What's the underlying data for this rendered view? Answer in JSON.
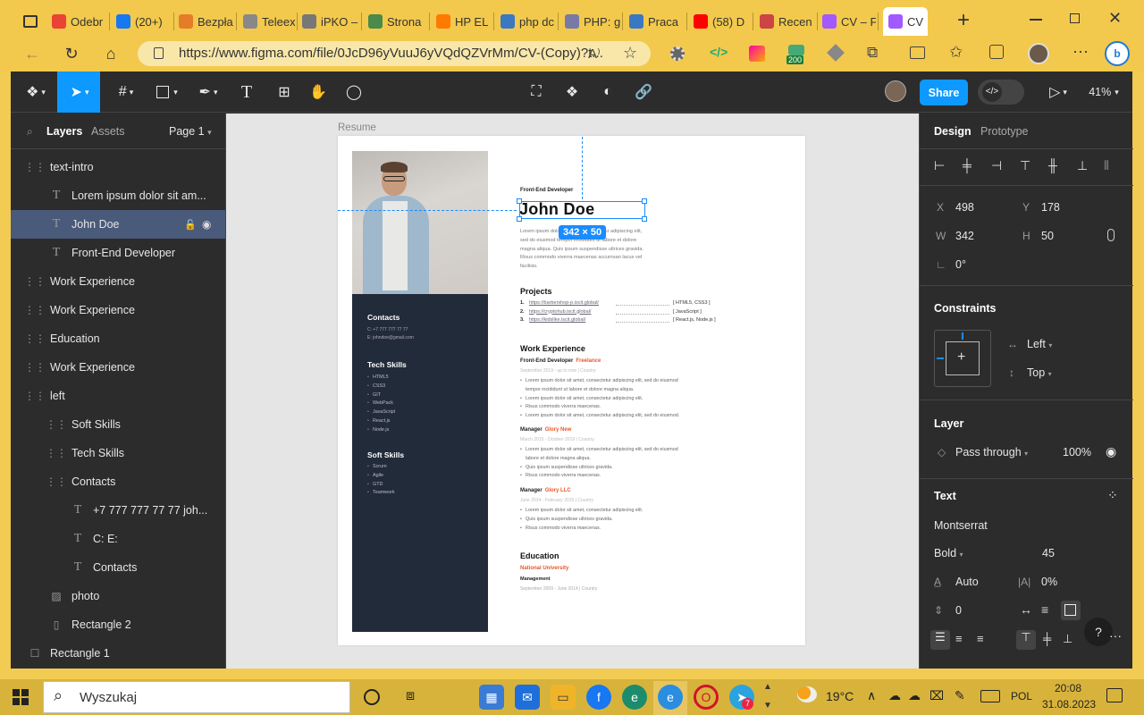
{
  "browser": {
    "tabs": [
      {
        "label": "",
        "color": "#444"
      },
      {
        "label": "Odebr",
        "color": "#ea4335"
      },
      {
        "label": "(20+)",
        "color": "#1877f2"
      },
      {
        "label": "Bezpła",
        "color": "#e57c2a"
      },
      {
        "label": "Teleex",
        "color": "#888"
      },
      {
        "label": "iPKO –",
        "color": "#777"
      },
      {
        "label": "Strona",
        "color": "#4a8a4a"
      },
      {
        "label": "HP EL",
        "color": "#ff7a00"
      },
      {
        "label": "php dc",
        "color": "#3a78c2"
      },
      {
        "label": "PHP: g",
        "color": "#777aa7"
      },
      {
        "label": "Praca",
        "color": "#3a78c2"
      },
      {
        "label": "(58) D",
        "color": "#ff0000"
      },
      {
        "label": "Recen",
        "color": "#c44"
      },
      {
        "label": "CV – F",
        "color": "#a259ff"
      },
      {
        "label": "CV",
        "color": "#a259ff"
      }
    ],
    "new_tab": "+",
    "url": "https://www.figma.com/file/0JcD96yVuuJ6yVQdQZVrMm/CV-(Copy)?t...",
    "badge": "200"
  },
  "figma": {
    "share_label": "Share",
    "zoom": "41%",
    "left_tabs": {
      "layers": "Layers",
      "assets": "Assets",
      "page": "Page 1"
    },
    "layers": [
      {
        "label": "text-intro",
        "indent": 1,
        "icon": "frame"
      },
      {
        "label": "Lorem ipsum dolor sit am...",
        "indent": 2,
        "icon": "text"
      },
      {
        "label": "John Doe",
        "indent": 2,
        "icon": "text",
        "selected": true
      },
      {
        "label": "Front-End Developer",
        "indent": 2,
        "icon": "text"
      },
      {
        "label": "Work Experience",
        "indent": 1,
        "icon": "frame"
      },
      {
        "label": "Work Experience",
        "indent": 1,
        "icon": "frame"
      },
      {
        "label": "Education",
        "indent": 1,
        "icon": "frame"
      },
      {
        "label": "Work Experience",
        "indent": 1,
        "icon": "frame"
      },
      {
        "label": "left",
        "indent": 1,
        "icon": "frame"
      },
      {
        "label": "Soft Skills",
        "indent": 2,
        "icon": "frame"
      },
      {
        "label": "Tech Skills",
        "indent": 2,
        "icon": "frame"
      },
      {
        "label": "Contacts",
        "indent": 2,
        "icon": "frame"
      },
      {
        "label": "+7 777 777 77 77 joh...",
        "indent": 3,
        "icon": "text"
      },
      {
        "label": "C: E:",
        "indent": 3,
        "icon": "text"
      },
      {
        "label": "Contacts",
        "indent": 3,
        "icon": "text"
      },
      {
        "label": "photo",
        "indent": 2,
        "icon": "image"
      },
      {
        "label": "Rectangle 2",
        "indent": 2,
        "icon": "rect-thin"
      },
      {
        "label": "Rectangle 1",
        "indent": 1,
        "icon": "rect"
      }
    ],
    "canvas": {
      "frame_label": "Resume",
      "size_badge": "342 × 50"
    },
    "right": {
      "tabs": {
        "design": "Design",
        "prototype": "Prototype"
      },
      "x_label": "X",
      "x": "498",
      "y_label": "Y",
      "y": "178",
      "w_label": "W",
      "w": "342",
      "h_label": "H",
      "h": "50",
      "rotation": "0°",
      "constraints_title": "Constraints",
      "constraint_h": "Left",
      "constraint_v": "Top",
      "layer_title": "Layer",
      "blend": "Pass through",
      "opacity": "100%",
      "text_title": "Text",
      "font": "Montserrat",
      "weight": "Bold",
      "size": "45",
      "line_height": "Auto",
      "letter_spacing": "0%",
      "para_spacing": "0",
      "help": "?"
    }
  },
  "cv": {
    "role": "Front-End Developer",
    "name": "John Doe",
    "intro": [
      "Lorem ipsum dolor sit amet, consectetur adipiscing elit,",
      "sed do eiusmod tempor incididunt ut labore et dolore",
      "magna aliqua. Quis ipsum suspendisse ultrices gravida.",
      "Risus commodo viverra maecenas accumsan lacus vel",
      "facilisis."
    ],
    "projects_title": "Projects",
    "projects": [
      {
        "n": "1.",
        "url": "https://barbershop-p.iscit.global/",
        "tech": "[ HTML5, CSS3 ]"
      },
      {
        "n": "2.",
        "url": "https://cryptohub.iscit.global/",
        "tech": "[ JavaScript ]"
      },
      {
        "n": "3.",
        "url": "https://kidslike.iscit.global/",
        "tech": "[ React.js, Node.js ]"
      }
    ],
    "work_title": "Work Experience",
    "jobs": [
      {
        "role": "Front-End Developer",
        "company": "Freelance",
        "dates": "September 2019 - up to now  |  Country",
        "bullets": [
          "Lorem ipsum dolor sit amet, consectetur adipiscing elit, sed do eiusmod",
          "tempor incididunt ut labore et dolore magna aliqua.",
          "Lorem ipsum dolor sit amet, consectetur adipiscing elit.",
          "Risus commodo viverra maecenas.",
          "Lorem ipsum dolor sit amet, consectetur adipiscing elit, sed do eiusmod."
        ]
      },
      {
        "role": "Manager",
        "company": "Glory New",
        "dates": "March 2015 - October 2019  |  Country",
        "bullets": [
          "Lorem ipsum dolor sit amet, consectetur adipiscing elit, sed do eiusmod",
          "labore et dolore magna aliqua.",
          "Quis ipsum suspendisse ultrices gravida.",
          "Risus commodo viverra maecenas."
        ]
      },
      {
        "role": "Manager",
        "company": "Glory LLC",
        "dates": "June 2014 - February 2015  |  Country",
        "bullets": [
          "Lorem ipsum dolor sit amet, consectetur adipiscing elit.",
          "Quis ipsum suspendisse ultrices gravida.",
          "Risus commodo viverra maecenas."
        ]
      }
    ],
    "edu_title": "Education",
    "university": "National University",
    "degree": "Management",
    "edu_dates": "September 2009 - June 2014  |  Country",
    "contacts_title": "Contacts",
    "phone": "C:  +7 777 777 77 77",
    "email": "E:  johndoe@gmail.com",
    "tech_title": "Tech Skills",
    "tech": [
      "HTML5",
      "CSS3",
      "GIT",
      "WebPack",
      "JavaScript",
      "React.js",
      "Node.js"
    ],
    "soft_title": "Soft Skills",
    "soft": [
      "Scrum",
      "Agile",
      "GTD",
      "Teamwork"
    ]
  },
  "taskbar": {
    "search": "Wyszukaj",
    "weather": "19°C",
    "lang": "POL",
    "time": "20:08",
    "date": "31.08.2023",
    "telegram_badge": "7"
  }
}
